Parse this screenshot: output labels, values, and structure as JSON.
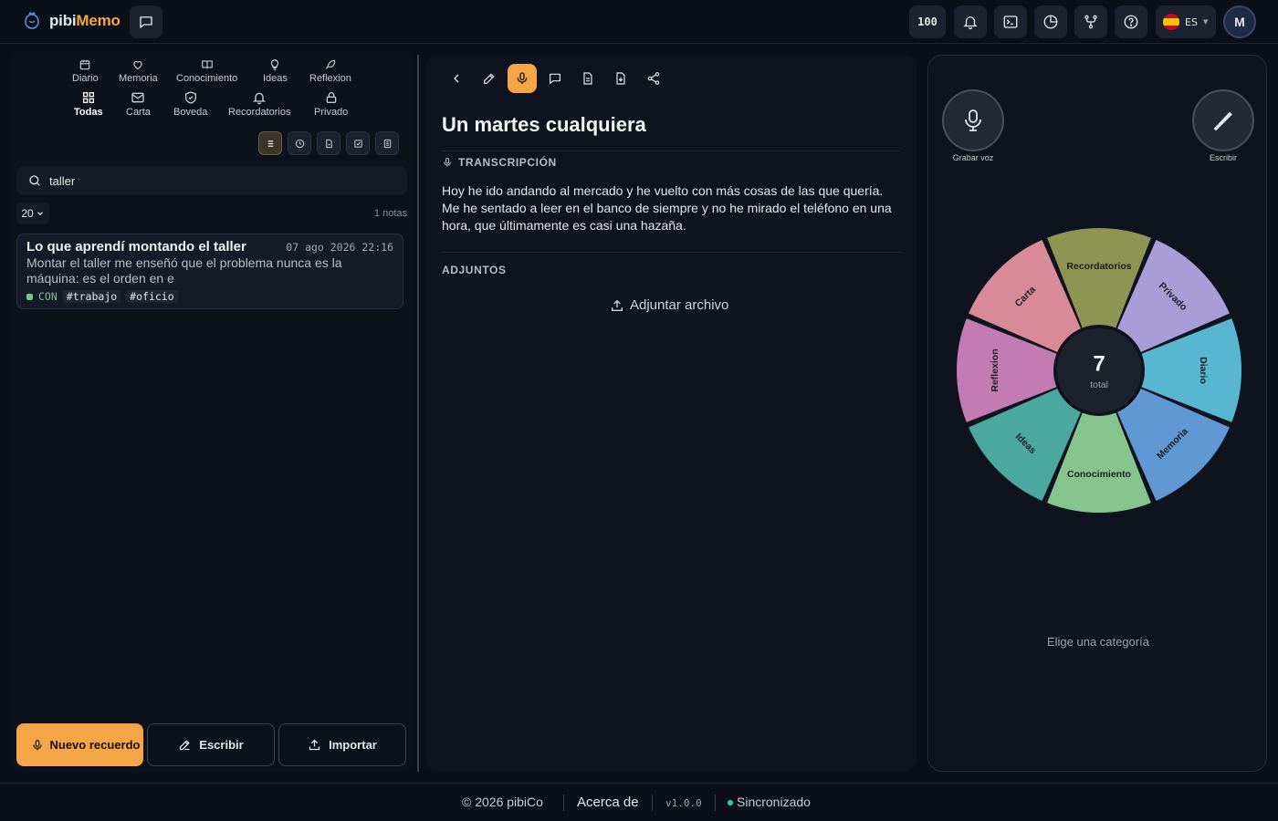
{
  "header": {
    "logo_prefix": "pibi",
    "logo_accent": "Memo",
    "count_badge": "100",
    "language_code": "ES",
    "avatar_initial": "M",
    "accent_color": "#f5a742"
  },
  "categories_row1": [
    {
      "label": "Diario",
      "icon": "calendar-icon"
    },
    {
      "label": "Memoria",
      "icon": "heart-icon"
    },
    {
      "label": "Conocimiento",
      "icon": "book-icon"
    },
    {
      "label": "Ideas",
      "icon": "lightbulb-icon"
    },
    {
      "label": "Reflexion",
      "icon": "feather-icon"
    }
  ],
  "categories_row2": [
    {
      "label": "Todas",
      "icon": "grid-icon",
      "active": true
    },
    {
      "label": "Carta",
      "icon": "envelope-icon"
    },
    {
      "label": "Boveda",
      "icon": "shield-icon"
    },
    {
      "label": "Recordatorios",
      "icon": "bell-icon"
    },
    {
      "label": "Privado",
      "icon": "lock-icon"
    }
  ],
  "search": {
    "value": "taller"
  },
  "list": {
    "page_size": "20",
    "count_label": "1 notas",
    "notes": [
      {
        "title": "Lo que aprendí montando el taller",
        "date": "07 ago 2026 22:16",
        "excerpt": "Montar el taller me enseñó que el problema nunca es la máquina: es el orden en e",
        "category_code": "CON",
        "tags": [
          "#trabajo",
          "#oficio"
        ]
      }
    ]
  },
  "actions": {
    "record_label": "Nuevo recuerdo",
    "write_label": "Escribir",
    "import_label": "Importar"
  },
  "editor": {
    "title": "Un martes cualquiera",
    "transcription_label": "TRANSCRIPCIÓN",
    "transcription": "Hoy he ido andando al mercado y he vuelto con más cosas de las que quería. Me he sentado a leer en el banco de siempre y no he mirado el teléfono en una hora, que últimamente es casi una hazaña.",
    "attachments_label": "ADJUNTOS",
    "attach_button": "Adjuntar archivo"
  },
  "wheel_panel": {
    "record_voice_label": "Grabar voz",
    "write_label": "Escribir",
    "total_value": "7",
    "total_label": "total",
    "hint": "Elige una categoría",
    "segments": [
      {
        "label": "Carta",
        "color": "#d98a98"
      },
      {
        "label": "Recordatorios",
        "color": "#8e9553"
      },
      {
        "label": "Privado",
        "color": "#a89dd6"
      },
      {
        "label": "Diario",
        "color": "#58b6d1"
      },
      {
        "label": "Memoria",
        "color": "#5f98d2"
      },
      {
        "label": "Conocimiento",
        "color": "#86c48e"
      },
      {
        "label": "Ideas",
        "color": "#4aa89f"
      },
      {
        "label": "Reflexion",
        "color": "#c27bb3"
      }
    ]
  },
  "footer": {
    "copyright": "© 2026 pibiCo",
    "about": "Acerca de",
    "version": "v1.0.0",
    "sync_status": "Sincronizado"
  }
}
